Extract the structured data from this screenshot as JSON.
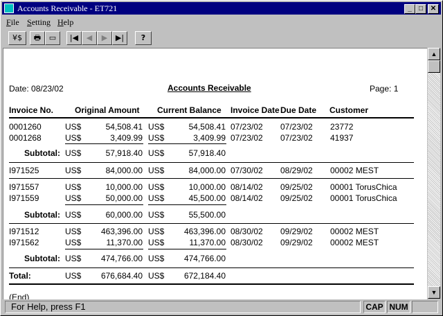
{
  "window": {
    "title": "Accounts Receivable - ET721",
    "min": "_",
    "max": "□",
    "close": "✕"
  },
  "menu": [
    {
      "label": "File",
      "ul": "F",
      "rest": "ile"
    },
    {
      "label": "Setting",
      "ul": "S",
      "rest": "etting"
    },
    {
      "label": "Help",
      "ul": "H",
      "rest": "elp"
    }
  ],
  "toolbar": {
    "currency": "¥$",
    "print": "🖶",
    "preview": "▭",
    "first": "|◀",
    "prev": "◀",
    "next": "▶",
    "last": "▶|",
    "help": "?"
  },
  "report": {
    "date": "Date: 08/23/02",
    "title": "Accounts Receivable",
    "page": "Page: 1",
    "headers": {
      "invoice": "Invoice No.",
      "original": "Original Amount",
      "current": "Current Balance",
      "inv_date": "Invoice Date",
      "due_date": "Due Date",
      "customer": "Customer"
    },
    "currency": "US$",
    "groups": [
      {
        "rows": [
          {
            "invoice": "0001260",
            "original": "54,508.41",
            "current": "54,508.41",
            "inv_date": "07/23/02",
            "due_date": "07/23/02",
            "customer": "23772"
          },
          {
            "invoice": "0001268",
            "original": "3,409.99",
            "current": "3,409.99",
            "inv_date": "07/23/02",
            "due_date": "07/23/02",
            "customer": "41937"
          }
        ],
        "subtotal": {
          "label": "Subtotal:",
          "original": "57,918.40",
          "current": "57,918.40"
        }
      },
      {
        "rows": [
          {
            "invoice": "I971525",
            "original": "84,000.00",
            "current": "84,000.00",
            "inv_date": "07/30/02",
            "due_date": "08/29/02",
            "customer": "00002 MEST"
          }
        ]
      },
      {
        "rows": [
          {
            "invoice": "I971557",
            "original": "10,000.00",
            "current": "10,000.00",
            "inv_date": "08/14/02",
            "due_date": "09/25/02",
            "customer": "00001 TorusChica"
          },
          {
            "invoice": "I971559",
            "original": "50,000.00",
            "current": "45,500.00",
            "inv_date": "08/14/02",
            "due_date": "09/25/02",
            "customer": "00001 TorusChica"
          }
        ],
        "subtotal": {
          "label": "Subtotal:",
          "original": "60,000.00",
          "current": "55,500.00"
        }
      },
      {
        "rows": [
          {
            "invoice": "I971512",
            "original": "463,396.00",
            "current": "463,396.00",
            "inv_date": "08/30/02",
            "due_date": "09/29/02",
            "customer": "00002 MEST"
          },
          {
            "invoice": "I971562",
            "original": "11,370.00",
            "current": "11,370.00",
            "inv_date": "08/30/02",
            "due_date": "09/29/02",
            "customer": "00002 MEST"
          }
        ],
        "subtotal": {
          "label": "Subtotal:",
          "original": "474,766.00",
          "current": "474,766.00"
        }
      }
    ],
    "total": {
      "label": "Total:",
      "original": "676,684.40",
      "current": "672,184.40"
    },
    "end": "(End)"
  },
  "status": {
    "text": "For Help, press F1",
    "cap": "CAP",
    "num": "NUM",
    "scroll_label": ""
  }
}
